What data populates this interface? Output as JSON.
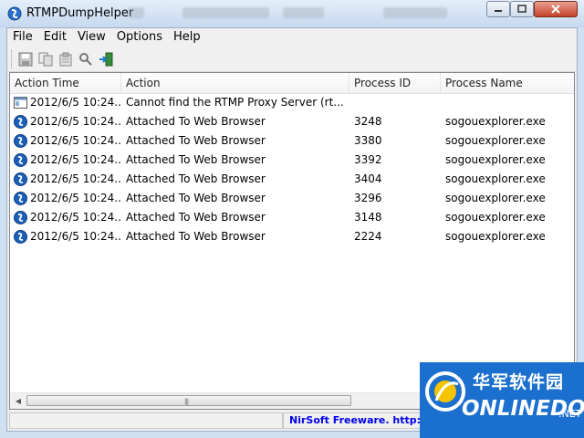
{
  "window": {
    "title": "RTMPDumpHelper"
  },
  "menu": [
    "File",
    "Edit",
    "View",
    "Options",
    "Help"
  ],
  "toolbar": {
    "icons": [
      "save-icon",
      "copy-icon",
      "properties-icon",
      "find-icon",
      "exit-icon"
    ]
  },
  "columns": [
    "Action Time",
    "Action",
    "Process ID",
    "Process Name"
  ],
  "rows": [
    {
      "time": "2012/6/5 10:24...",
      "action": "Cannot find  the RTMP Proxy Server (rt...",
      "pid": "",
      "process": "",
      "icon": "window-icon"
    },
    {
      "time": "2012/6/5 10:24...",
      "action": "Attached To Web Browser",
      "pid": "3248",
      "process": "sogouexplorer.exe",
      "icon": "sogou-icon"
    },
    {
      "time": "2012/6/5 10:24...",
      "action": "Attached To Web Browser",
      "pid": "3380",
      "process": "sogouexplorer.exe",
      "icon": "sogou-icon"
    },
    {
      "time": "2012/6/5 10:24...",
      "action": "Attached To Web Browser",
      "pid": "3392",
      "process": "sogouexplorer.exe",
      "icon": "sogou-icon"
    },
    {
      "time": "2012/6/5 10:24...",
      "action": "Attached To Web Browser",
      "pid": "3404",
      "process": "sogouexplorer.exe",
      "icon": "sogou-icon"
    },
    {
      "time": "2012/6/5 10:24...",
      "action": "Attached To Web Browser",
      "pid": "3296",
      "process": "sogouexplorer.exe",
      "icon": "sogou-icon"
    },
    {
      "time": "2012/6/5 10:24...",
      "action": "Attached To Web Browser",
      "pid": "3148",
      "process": "sogouexplorer.exe",
      "icon": "sogou-icon"
    },
    {
      "time": "2012/6/5 10:24...",
      "action": "Attached To Web Browser",
      "pid": "2224",
      "process": "sogouexplorer.exe",
      "icon": "sogou-icon"
    }
  ],
  "status": {
    "link_text": "NirSoft Freeware.  http://w"
  },
  "watermark": {
    "cn": "华军软件园",
    "en": "ONLINEDOWN",
    "suffix": ".NET"
  },
  "colors": {
    "titlebar": "#cfe0f2",
    "link": "#0000ee",
    "watermark": "#1b6fce"
  }
}
